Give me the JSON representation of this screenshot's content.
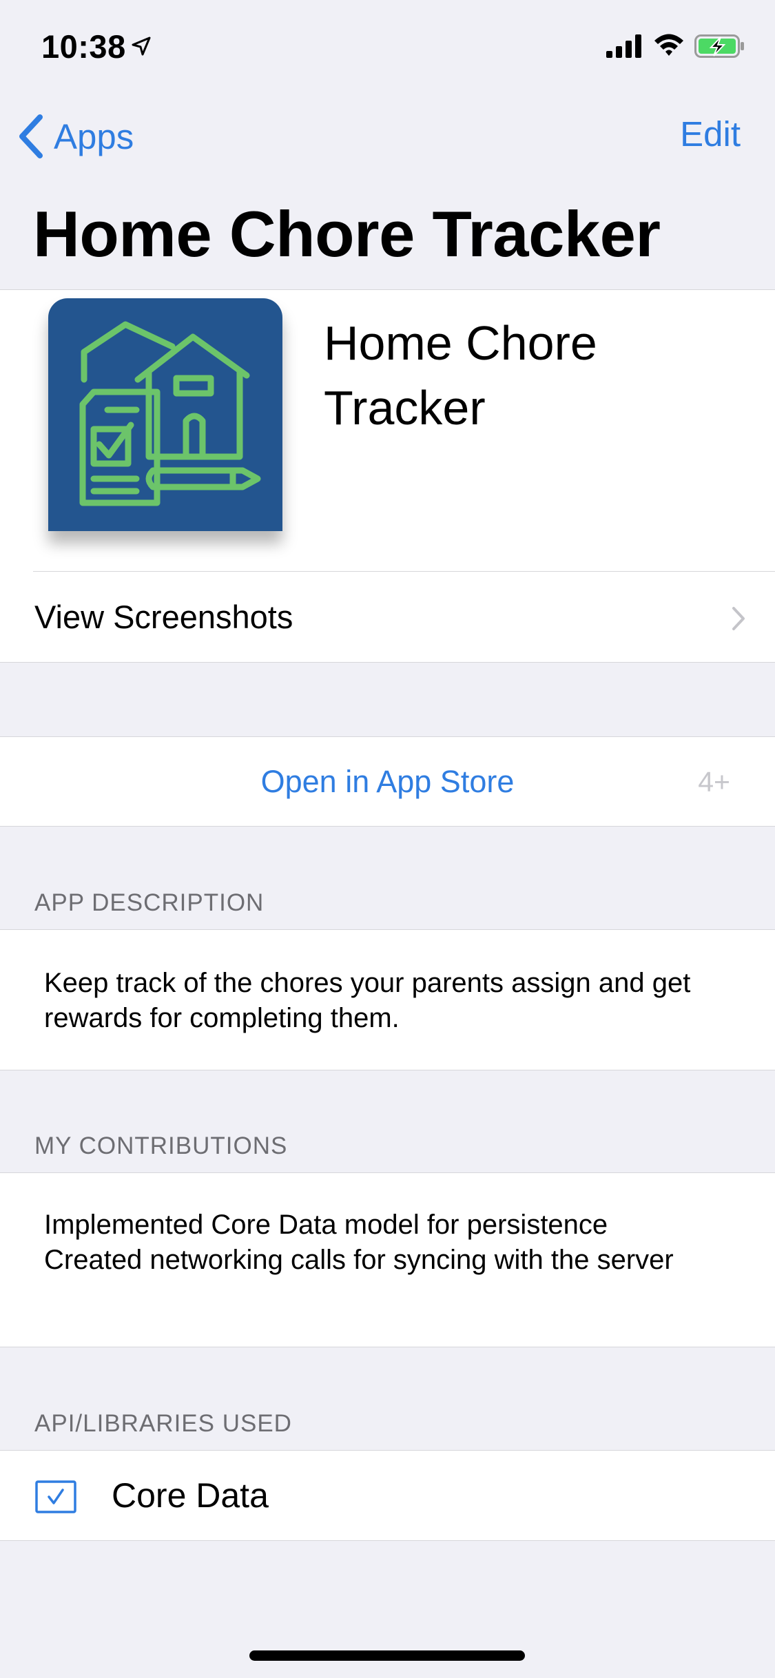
{
  "status_bar": {
    "time": "10:38",
    "icons": [
      "location-arrow-icon",
      "cellular-signal-icon",
      "wifi-icon",
      "battery-charging-icon"
    ]
  },
  "nav": {
    "back_label": "Apps",
    "edit_label": "Edit"
  },
  "page_title": "Home Chore Tracker",
  "app": {
    "name": "Home Chore Tracker",
    "icon": "house-checklist-pencil-icon",
    "icon_bg_color": "#23558f",
    "icon_line_color": "#6cc46a",
    "view_screenshots_label": "View Screenshots"
  },
  "store": {
    "open_label": "Open in App Store",
    "age_rating": "4+"
  },
  "sections": {
    "description": {
      "header": "APP DESCRIPTION",
      "text": "Keep track of the chores your parents assign and get rewards for completing them."
    },
    "contributions": {
      "header": "MY CONTRIBUTIONS",
      "text": "Implemented Core Data model for persistence\nCreated networking calls for syncing with the server"
    },
    "libraries": {
      "header": "API/LIBRARIES USED",
      "items": [
        {
          "label": "Core Data",
          "checked": true
        }
      ]
    }
  },
  "colors": {
    "accent": "#2f7de1",
    "background": "#f0f0f6",
    "secondary_text": "#6d6d72",
    "disabled_text": "#c7c7cc"
  }
}
